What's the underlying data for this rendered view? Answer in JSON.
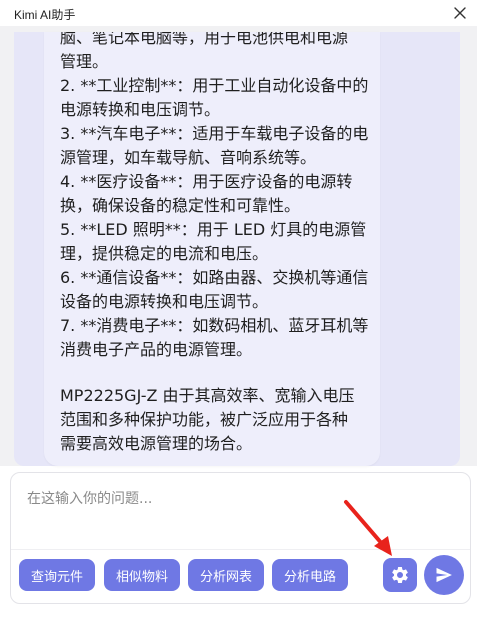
{
  "window": {
    "title": "Kimi AI助手",
    "close_icon": "close-icon"
  },
  "message": {
    "lines": [
      "脑、笔记本电脑等，用于电池供电和电源",
      "管理。",
      "2. **工业控制**：用于工业自动化设备中的",
      "电源转换和电压调节。",
      "3. **汽车电子**：适用于车载电子设备的电",
      "源管理，如车载导航、音响系统等。",
      "4. **医疗设备**：用于医疗设备的电源转",
      "换，确保设备的稳定性和可靠性。",
      "5. **LED 照明**：用于 LED 灯具的电源管",
      "理，提供稳定的电流和电压。",
      "6. **通信设备**：如路由器、交换机等通信",
      "设备的电源转换和电压调节。",
      "7. **消费电子**：如数码相机、蓝牙耳机等",
      "消费电子产品的电源管理。"
    ],
    "summary_lines": [
      "MP2225GJ-Z 由于其高效率、宽输入电压",
      "范围和多种保护功能，被广泛应用于各种",
      "需要高效电源管理的场合。"
    ]
  },
  "input": {
    "placeholder": "在这输入你的问题...",
    "value": ""
  },
  "quick_actions": [
    {
      "label": "查询元件"
    },
    {
      "label": "相似物料"
    },
    {
      "label": "分析网表"
    },
    {
      "label": "分析电路"
    }
  ],
  "icons": {
    "settings": "gear-icon",
    "send": "send-icon",
    "annotation": "red-arrow-icon"
  },
  "colors": {
    "accent": "#6f78e4",
    "chat_bg": "#f1f1f3",
    "bubble_bg": "#eeeefb",
    "annotation_arrow": "#e8231c"
  }
}
